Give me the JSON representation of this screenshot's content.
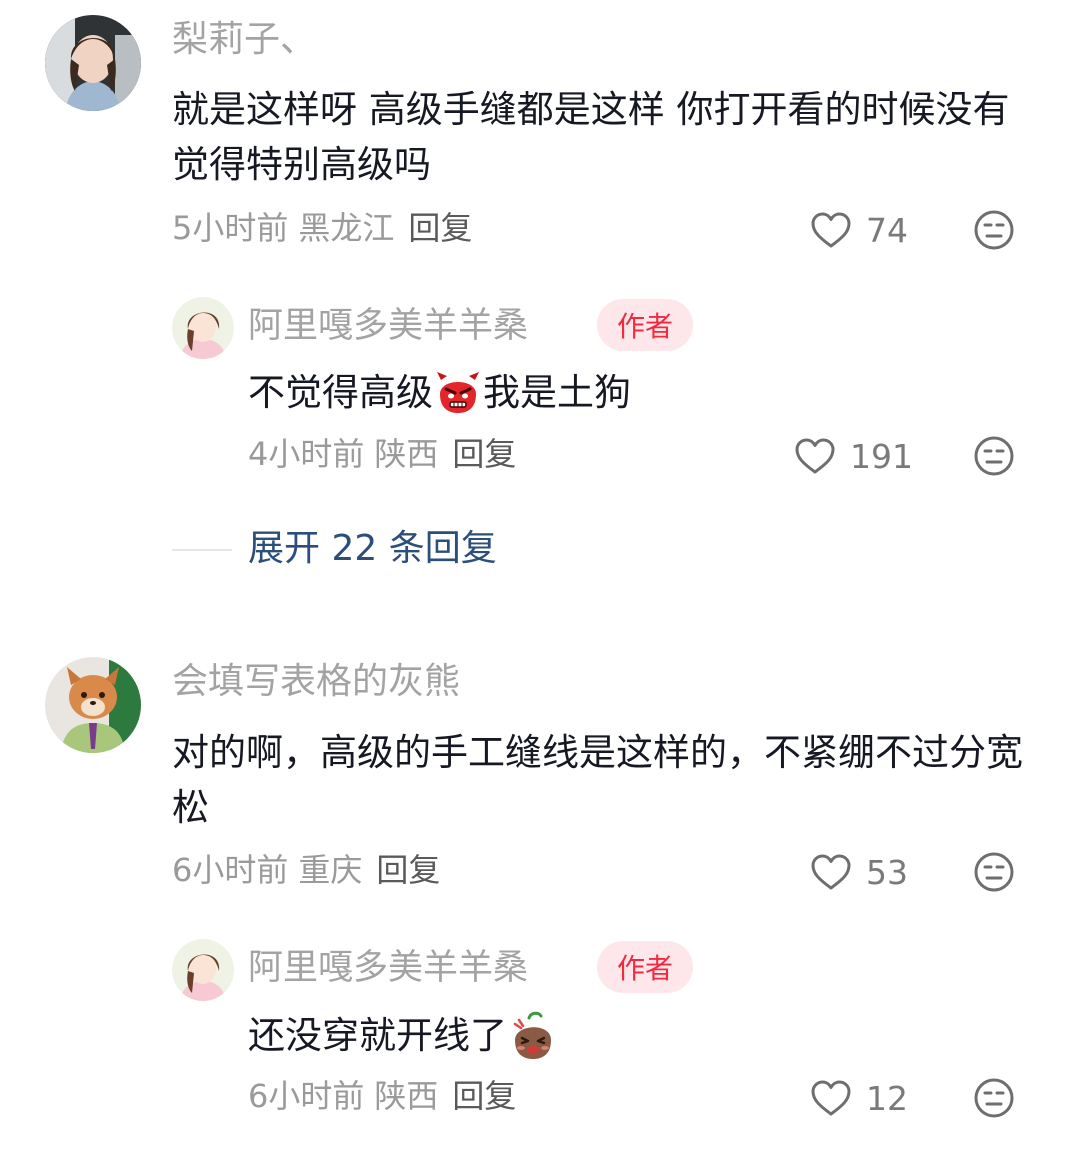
{
  "comments": [
    {
      "username": "梨莉子、",
      "text": "就是这样呀 高级手缝都是这样 你打开看的时候没有觉得特别高级吗",
      "time": "5小时前",
      "location": "黑龙江",
      "reply_label": "回复",
      "likes": "74",
      "replies": [
        {
          "username": "阿里嘎多美羊羊桑",
          "badge": "作者",
          "text_before": "不觉得高级",
          "emoji": "angry-red-face",
          "text_after": "我是土狗",
          "time": "4小时前",
          "location": "陕西",
          "reply_label": "回复",
          "likes": "191"
        }
      ],
      "expand_label": "展开 22 条回复"
    },
    {
      "username": "会填写表格的灰熊",
      "text": "对的啊，高级的手工缝线是这样的，不紧绷不过分宽松",
      "time": "6小时前",
      "location": "重庆",
      "reply_label": "回复",
      "likes": "53",
      "replies": [
        {
          "username": "阿里嘎多美羊羊桑",
          "badge": "作者",
          "text_before": "还没穿就开线了",
          "emoji": "sweating-potato",
          "text_after": "",
          "time": "6小时前",
          "location": "陕西",
          "reply_label": "回复",
          "likes": "12"
        }
      ]
    }
  ],
  "colors": {
    "username": "#a3a3a3",
    "text": "#161823",
    "meta": "#9a9a9a",
    "badge_bg": "#fde7ea",
    "badge_text": "#f22a3f",
    "expand": "#2b4f7a"
  }
}
